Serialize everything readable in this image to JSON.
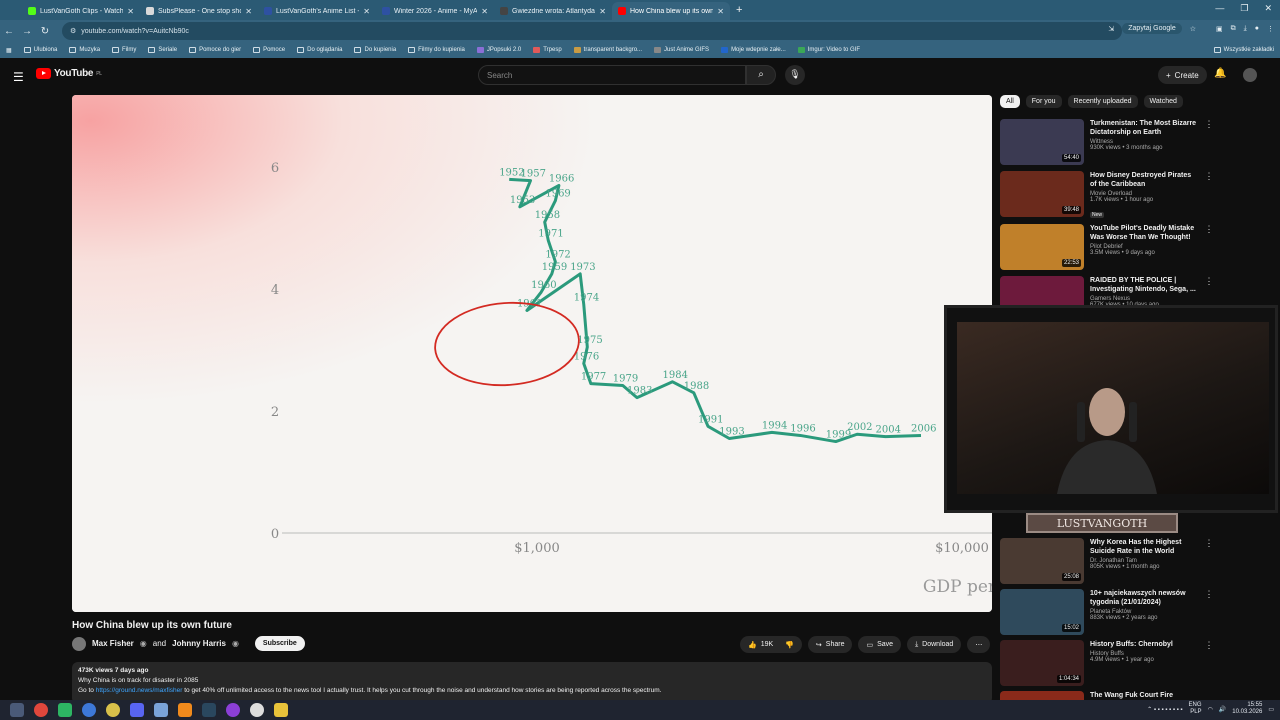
{
  "browser": {
    "tabs": [
      {
        "title": "LustVanGoth Clips - Watch Live",
        "color": "#53fc18"
      },
      {
        "title": "SubsPlease - One stop shop fo",
        "color": "#d9d9d9"
      },
      {
        "title": "LustVanGoth's Anime List - My",
        "color": "#2e51a2"
      },
      {
        "title": "Winter 2026 - Anime - MyAnim",
        "color": "#2e51a2"
      },
      {
        "title": "Gwiezdne wrota: Atlantyda / St",
        "color": "#444444"
      },
      {
        "title": "How China blew up its own",
        "color": "#ff0000"
      }
    ],
    "url": "youtube.com/watch?v=AuitcNb90c",
    "ask_google": "Zapytaj Google",
    "bookmarks": [
      "Ulubiona",
      "Muzyka",
      "Filmy",
      "Seriale",
      "Pomoce do gier",
      "Pomoce",
      "Do oglądania",
      "Do kupienia",
      "Filmy do kupienia",
      "JPopsuki 2.0",
      "Trpesp",
      "transparent backgro...",
      "Just Anime GIFS",
      "Moje wdepnie załe...",
      "Imgur: Video to GIF"
    ],
    "all_bookmarks": "Wszystkie zakładki"
  },
  "youtube": {
    "logo": "YouTube",
    "region": "PL",
    "search_placeholder": "Search",
    "create": "Create"
  },
  "video": {
    "title": "How China blew up its own future",
    "channel": "Max Fisher",
    "and": "and",
    "collab": "Johnny Harris",
    "subscribe": "Subscribe",
    "likes": "19K",
    "share": "Share",
    "save": "Save",
    "download": "Download",
    "meta": "473K views  7 days ago",
    "desc_line1": "Why China is on track for disaster in 2085",
    "desc_line2_pre": "Go to",
    "desc_link": "https://ground.news/maxfisher",
    "desc_line2_post": "to get 40% off unlimited access to the news tool I actually trust. It helps you cut through the noise and understand how stories are being reported across the spectrum."
  },
  "chart_data": {
    "type": "line",
    "xlabel": "GDP per ca",
    "y_ticks": [
      "6",
      "4",
      "2",
      "0"
    ],
    "x_ticks": [
      "$1,000",
      "$10,000"
    ],
    "series": [
      {
        "points": [
          {
            "label": "1952",
            "x": 320,
            "y": 5.8
          },
          {
            "label": "1957",
            "x": 350,
            "y": 5.78
          },
          {
            "label": "1953",
            "x": 335,
            "y": 5.35
          },
          {
            "label": "1966",
            "x": 390,
            "y": 5.7
          },
          {
            "label": "1969",
            "x": 385,
            "y": 5.45
          },
          {
            "label": "1958",
            "x": 370,
            "y": 5.1
          },
          {
            "label": "1971",
            "x": 375,
            "y": 4.8
          },
          {
            "label": "1972",
            "x": 385,
            "y": 4.45
          },
          {
            "label": "1959",
            "x": 380,
            "y": 4.25
          },
          {
            "label": "1960",
            "x": 365,
            "y": 3.95
          },
          {
            "label": "1961",
            "x": 345,
            "y": 3.65
          },
          {
            "label": "1973",
            "x": 420,
            "y": 4.25
          },
          {
            "label": "1974",
            "x": 425,
            "y": 3.75
          },
          {
            "label": "1975",
            "x": 430,
            "y": 3.05
          },
          {
            "label": "1976",
            "x": 425,
            "y": 2.78
          },
          {
            "label": "1977",
            "x": 435,
            "y": 2.45
          },
          {
            "label": "1979",
            "x": 480,
            "y": 2.42
          },
          {
            "label": "1983",
            "x": 500,
            "y": 2.22
          },
          {
            "label": "1984",
            "x": 550,
            "y": 2.48
          },
          {
            "label": "1988",
            "x": 580,
            "y": 2.3
          },
          {
            "label": "1991",
            "x": 600,
            "y": 1.75
          },
          {
            "label": "1993",
            "x": 630,
            "y": 1.55
          },
          {
            "label": "1994",
            "x": 690,
            "y": 1.65
          },
          {
            "label": "1996",
            "x": 730,
            "y": 1.6
          },
          {
            "label": "1999",
            "x": 780,
            "y": 1.5
          },
          {
            "label": "2002",
            "x": 810,
            "y": 1.62
          },
          {
            "label": "2004",
            "x": 850,
            "y": 1.58
          },
          {
            "label": "2006",
            "x": 900,
            "y": 1.6
          }
        ]
      }
    ]
  },
  "recommendations": {
    "chips": [
      "All",
      "For you",
      "Recently uploaded",
      "Watched"
    ],
    "items": [
      {
        "title": "Turkmenistan: The Most Bizarre Dictatorship on Earth",
        "channel": "Wittness",
        "meta": "930K views • 3 months ago",
        "duration": "54:40",
        "color": "#3b3a52"
      },
      {
        "title": "How Disney Destroyed Pirates of the Caribbean",
        "channel": "Movie Overload",
        "meta": "1.7K views • 1 hour ago",
        "badge": "New",
        "duration": "39:48",
        "color": "#6b2a1c"
      },
      {
        "title": "YouTube Pilot's Deadly Mistake Was Worse Than We Thought!",
        "channel": "Pilot Debrief",
        "meta": "3.5M views • 9 days ago",
        "duration": "22:53",
        "color": "#c0802a"
      },
      {
        "title": "RAIDED BY THE POLICE | Investigating Nintendo, Sega, ...",
        "channel": "Gamers Nexus",
        "meta": "677K views • 10 days ago",
        "duration": "",
        "color": "#6d1a3c"
      },
      {
        "title": "Why Korea Has the Highest Suicide Rate in the World",
        "channel": "Dr. Jonathan Tam",
        "meta": "805K views • 1 month ago",
        "duration": "25:08",
        "color": "#4a3a32"
      },
      {
        "title": "10+ najciekawszych newsów tygodnia (21/01/2024)",
        "channel": "Planeta Faktów",
        "meta": "883K views • 2 years ago",
        "duration": "15:02",
        "color": "#2f4a5c"
      },
      {
        "title": "History Buffs: Chernobyl",
        "channel": "History Buffs",
        "meta": "4.9M views • 1 year ago",
        "duration": "1:04:34",
        "color": "#3a1e1e"
      },
      {
        "title": "The Wang Fuk Court Fire",
        "channel": "",
        "meta": "",
        "duration": "",
        "color": "#8a2a1a"
      }
    ]
  },
  "overlay": {
    "banner": "LUSTVANGOTH"
  },
  "taskbar": {
    "lang1": "ENG",
    "lang2": "PLP",
    "time": "15:55",
    "date": "10.03.2026"
  }
}
